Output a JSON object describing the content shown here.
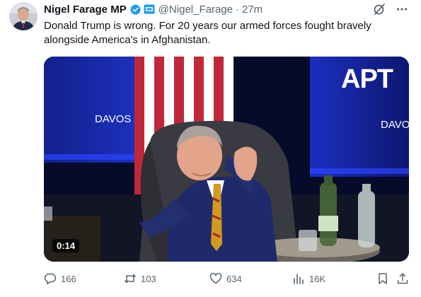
{
  "tweet": {
    "display_name": "Nigel Farage MP",
    "handle": "@Nigel_Farage",
    "separator": "·",
    "time": "27m",
    "text": "Donald Trump is wrong. For 20 years our armed forces fought bravely alongside America's in Afghanistan."
  },
  "media": {
    "duration": "0:14",
    "banner_text": "DAVOS",
    "logo_text": "APT"
  },
  "stats": {
    "replies": "166",
    "reposts": "103",
    "likes": "634",
    "views": "16K"
  },
  "colors": {
    "verified_badge": "#1d9bf0",
    "affiliate_badge": "#1d9bf0",
    "muted_text": "#536471",
    "primary_text": "#0f1419"
  }
}
